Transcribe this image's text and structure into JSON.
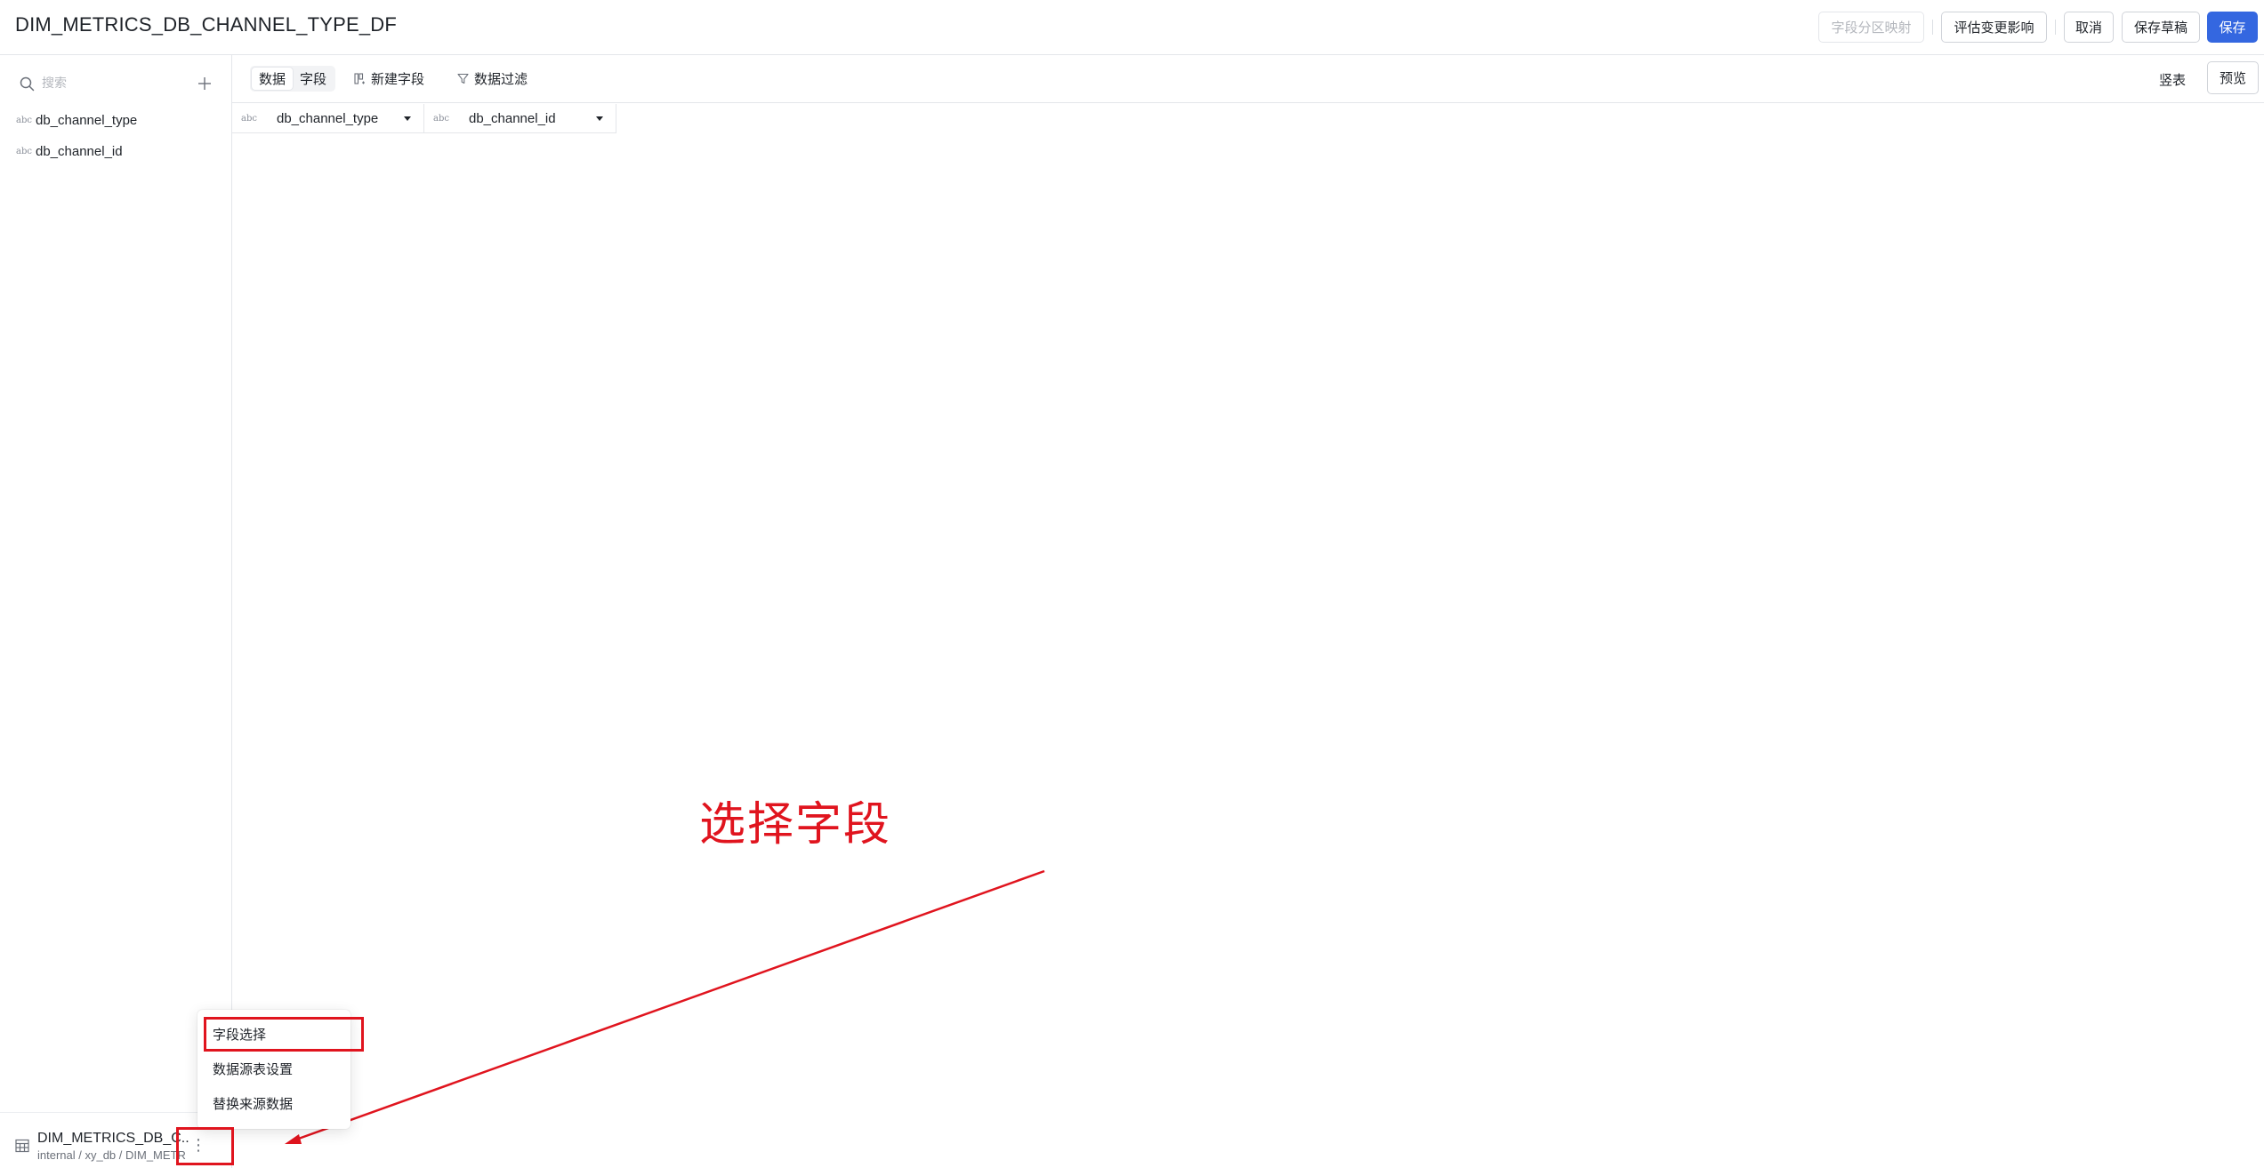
{
  "header": {
    "title": "DIM_METRICS_DB_CHANNEL_TYPE_DF",
    "buttons": {
      "partition_mapping": "字段分区映射",
      "evaluate_impact": "评估变更影响",
      "cancel": "取消",
      "save_draft": "保存草稿",
      "save": "保存"
    }
  },
  "sidebar": {
    "search": {
      "placeholder": "搜索",
      "value": ""
    },
    "fields": [
      {
        "type": "abc",
        "name": "db_channel_type"
      },
      {
        "type": "abc",
        "name": "db_channel_id"
      }
    ],
    "table": {
      "name": "DIM_METRICS_DB_C...",
      "path": "internal / xy_db / DIM_METR"
    }
  },
  "toolbar": {
    "tabs": [
      {
        "label": "数据",
        "active": true
      },
      {
        "label": "字段",
        "active": false
      }
    ],
    "new_field": "新建字段",
    "data_filter": "数据过滤",
    "vertical": "竖表",
    "preview": "预览"
  },
  "grid": {
    "columns": [
      {
        "type": "abc",
        "name": "db_channel_type"
      },
      {
        "type": "abc",
        "name": "db_channel_id"
      }
    ]
  },
  "context_menu": {
    "items": [
      "字段选择",
      "数据源表设置",
      "替换来源数据"
    ]
  },
  "annotation": {
    "text": "选择字段",
    "color": "#e0141e"
  },
  "colors": {
    "primary": "#3467e0",
    "annotation_red": "#e0141e",
    "border": "#e4e6ea"
  }
}
